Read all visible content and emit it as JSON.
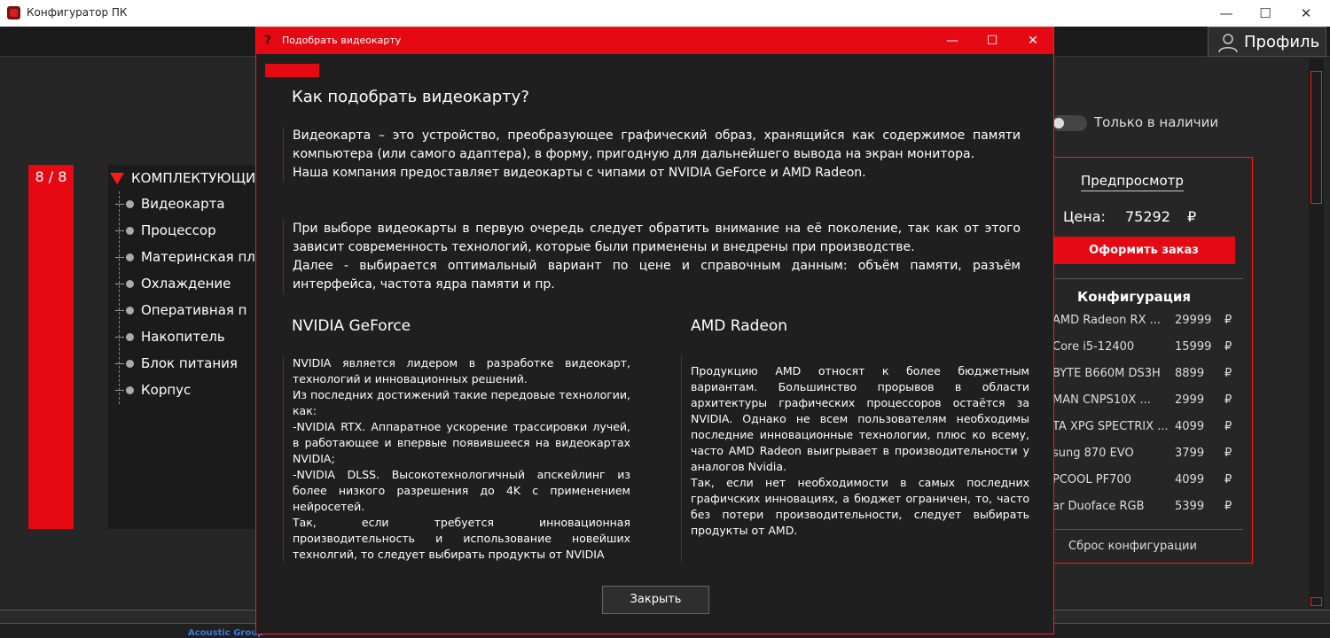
{
  "window": {
    "title": "Конфигуратор ПК",
    "minimize": "—",
    "maximize": "☐",
    "close": "✕"
  },
  "header": {
    "profile_label": "Профиль"
  },
  "progress": {
    "label": "8 / 8"
  },
  "tree": {
    "heading": "КОМПЛЕКТУЮЩИ",
    "items": [
      "Видеокарта",
      "Процессор",
      "Материнская пл",
      "Охлаждение",
      "Оперативная п",
      "Накопитель",
      "Блок питания",
      "Корпус"
    ]
  },
  "filter": {
    "in_stock_label": "Только в наличии"
  },
  "preview": {
    "title": "Предпросмотр",
    "price_label": "Цена:",
    "price_value": "75292",
    "currency": "₽",
    "order_button": "Оформить заказ",
    "config_title": "Конфигурация",
    "config": [
      {
        "name": "AMD Radeon RX ...",
        "price": "29999",
        "currency": "₽"
      },
      {
        "name": "Core i5-12400",
        "price": "15999",
        "currency": "₽"
      },
      {
        "name": "BYTE B660M DS3H",
        "price": "8899",
        "currency": "₽"
      },
      {
        "name": "MAN CNPS10X ...",
        "price": "2999",
        "currency": "₽"
      },
      {
        "name": "TA XPG SPECTRIX ...",
        "price": "4099",
        "currency": "₽"
      },
      {
        "name": "sung 870 EVO",
        "price": "3799",
        "currency": "₽"
      },
      {
        "name": "PCOOL PF700",
        "price": "4099",
        "currency": "₽"
      },
      {
        "name": "ar Duoface RGB",
        "price": "5399",
        "currency": "₽"
      }
    ],
    "reset_label": "Сброс конфигурации"
  },
  "footer": {
    "partial_text": "Acoustic Group"
  },
  "modal": {
    "title": "Подобрать видеокарту",
    "heading": "Как подобрать видеокарту?",
    "paragraph1": "Видеокарта – это устройство, преобразующее графический образ, хранящийся как содержимое памяти компьютера (или самого адаптера), в форму, пригодную для дальнейшего вывода на экран монитора.",
    "paragraph1b": "Наша компания предоставляет видеокарты с чипами от NVIDIA GeForce и AMD Radeon.",
    "paragraph2": "При выборе видеокарты в первую очередь следует обратить внимание на её поколение, так как от этого зависит современность технологий, которые были применены и внедрены при производстве.",
    "paragraph2b": "Далее - выбирается оптимальный вариант по цене и справочным данным: объём памяти, разъём интерфейса, частота ядра памяти и пр.",
    "nvidia_title": "NVIDIA GeForce",
    "nvidia_text": "NVIDIA является лидером в разработке видеокарт, технологий и инновационных решений.\nИз последних достижений такие передовые технологии, как:\n-NVIDIA RTX. Аппаратное ускорение трассировки лучей, в работающее и впервые появившееся на видеокартах NVIDIA;\n-NVIDIA DLSS. Высокотехнологичный апскейлинг из более низкого разрешения  до 4K с применением нейросетей.\nТак, если требуется инновационная производительность и использование новейших технолгий, то следует выбирать продукты от NVIDIA",
    "amd_title": "AMD Radeon",
    "amd_text": "Продукцию AMD относят к более бюджетным вариантам. Большинство прорывов в области архитектуры графических процессоров остаётся за NVIDIA. Однако не всем пользователям необходимы последние инновационные технологии, плюс ко всему, часто AMD Radeon выигрывает в производительности у аналогов Nvidia.\nТак, если нет необходимости в самых последних графичских инновациях, а бюджет ограничен, то, часто без потери производительности, следует выбирать продукты от AMD.",
    "close_button": "Закрыть"
  },
  "colors": {
    "accent": "#e50914",
    "background": "#262626",
    "modal_background": "#1f1f1f"
  }
}
